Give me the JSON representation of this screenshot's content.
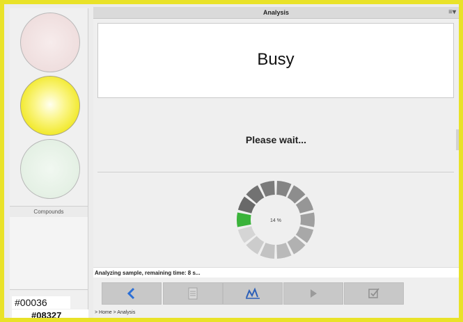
{
  "left_panel": {
    "compounds_label": "Compounds",
    "sample_id_1": "#00036",
    "sample_id_2": "#08327"
  },
  "window": {
    "title": "Analysis",
    "menu_glyph": "≡▾"
  },
  "main": {
    "status_heading": "Busy",
    "message": "Please wait...",
    "progress_label": "14 %",
    "progress": 0.14,
    "status_line": "Analyzing sample, remaining time: 8 s..."
  },
  "toolbar": {
    "buttons": [
      {
        "name": "back",
        "icon": "chevron-left-icon"
      },
      {
        "name": "document",
        "icon": "document-icon"
      },
      {
        "name": "analyze",
        "icon": "analyze-icon"
      },
      {
        "name": "play",
        "icon": "play-icon"
      },
      {
        "name": "confirm",
        "icon": "checkbox-icon"
      }
    ]
  },
  "breadcrumb": "> Home > Analysis",
  "colors": {
    "frame": "#e9e228",
    "light_active": "#f1e825",
    "progress_active": "#3ab33a",
    "back_icon": "#2b6fd6"
  }
}
